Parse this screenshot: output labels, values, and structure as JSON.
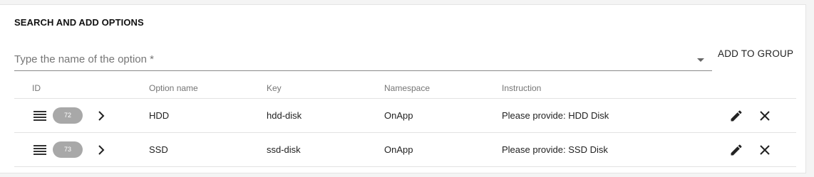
{
  "section": {
    "title": "SEARCH AND ADD OPTIONS"
  },
  "search": {
    "placeholder": "Type the name of the option *",
    "value": "",
    "dropdown_icon": "arrow-drop-down-icon"
  },
  "add_button": {
    "label": "ADD TO GROUP"
  },
  "table": {
    "headers": {
      "id": "ID",
      "option_name": "Option name",
      "key": "Key",
      "namespace": "Namespace",
      "instruction": "Instruction"
    },
    "rows": [
      {
        "id": "72",
        "option_name": "HDD",
        "key": "hdd-disk",
        "namespace": "OnApp",
        "instruction": "Please provide: HDD Disk"
      },
      {
        "id": "73",
        "option_name": "SSD",
        "key": "ssd-disk",
        "namespace": "OnApp",
        "instruction": "Please provide: SSD Disk"
      }
    ],
    "row_icons": [
      "drag-handle-icon",
      "chevron-right-icon",
      "edit-pencil-icon",
      "close-icon"
    ]
  },
  "colors": {
    "chip_background": "#a8a8a8",
    "divider": "#e2e2e2",
    "page_background": "#f4f4f4"
  }
}
